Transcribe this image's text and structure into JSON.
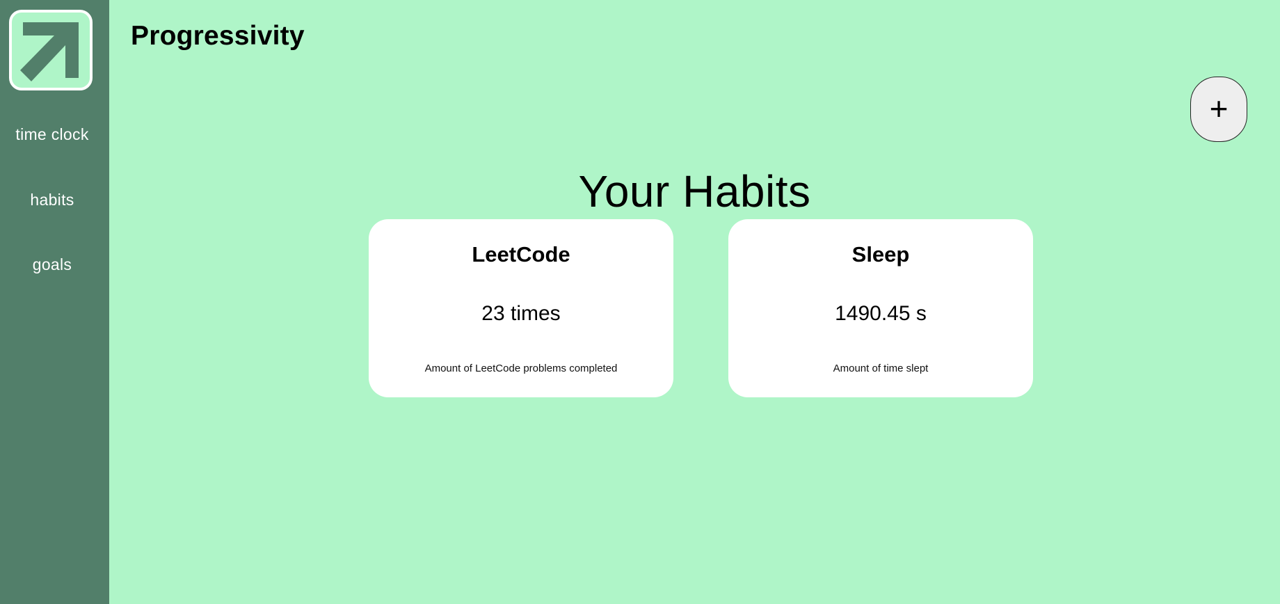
{
  "app": {
    "title": "Progressivity",
    "logo_icon": "arrow-up-right-icon"
  },
  "colors": {
    "background": "#aff5c8",
    "sidebar": "#527f6a",
    "card": "#ffffff",
    "add_button": "#eeeeee"
  },
  "sidebar": {
    "items": [
      {
        "label": "time clock"
      },
      {
        "label": "habits"
      },
      {
        "label": "goals"
      }
    ]
  },
  "main": {
    "add_button_label": "+",
    "section_title": "Your Habits",
    "habits": [
      {
        "name": "LeetCode",
        "value": "23 times",
        "description": "Amount of LeetCode problems completed"
      },
      {
        "name": "Sleep",
        "value": "1490.45 s",
        "description": "Amount of time slept"
      }
    ]
  }
}
